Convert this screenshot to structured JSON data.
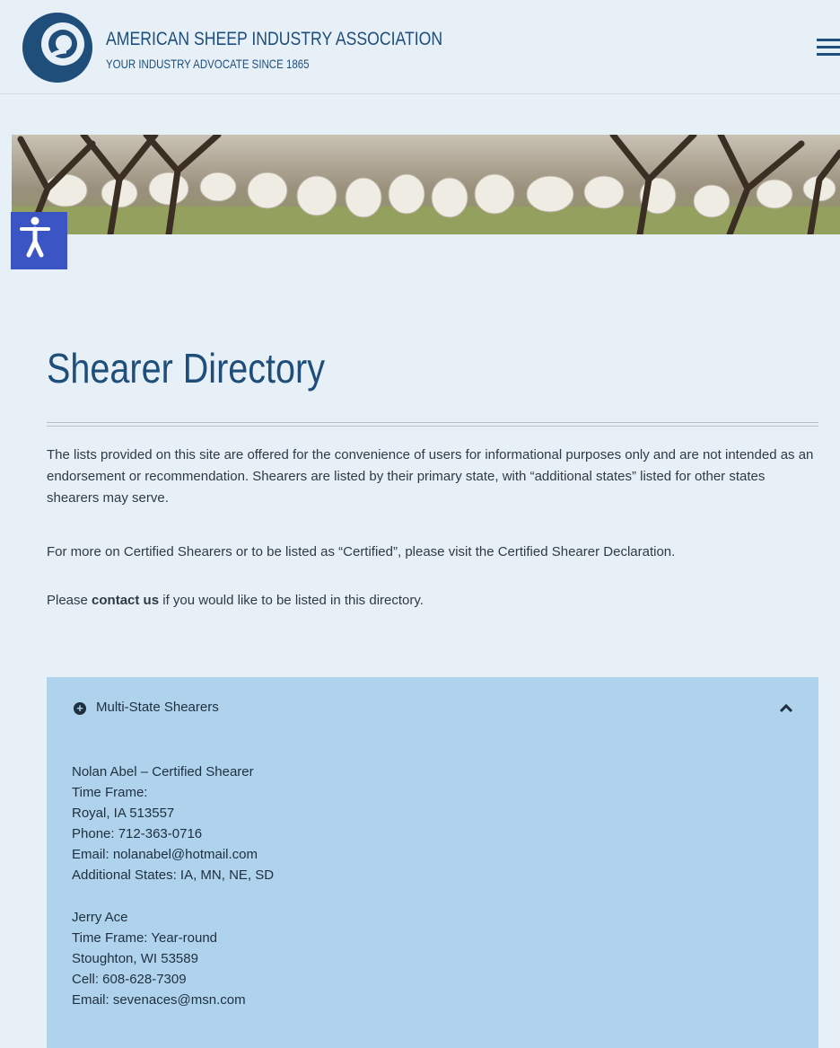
{
  "header": {
    "org_name": "AMERICAN SHEEP INDUSTRY ASSOCIATION",
    "tagline": "YOUR INDUSTRY ADVOCATE SINCE 1865",
    "colors": {
      "brand": "#1e4e79",
      "accessibility": "#3c55c4",
      "panel": "#afd3ec"
    }
  },
  "page": {
    "title": "Shearer Directory",
    "intro": "The lists provided on this site are offered for the convenience of users for informational purposes only and are not intended as an endorsement or recommendation. Shearers are listed by their primary state, with “additional states” listed for other states shearers may serve.",
    "certified_note": "For more on Certified Shearers or to be listed as “Certified”, please visit the Certified Shearer Declaration.",
    "contact_prefix": "Please ",
    "contact_link": "contact us",
    "contact_suffix": " if you would like to be listed in this directory."
  },
  "accordion": {
    "title": "Multi-State Shearers",
    "entries": [
      {
        "name": "Nolan Abel – Certified Shearer",
        "time_frame": "Time Frame:",
        "location": "Royal, IA 513557",
        "phone": "Phone: 712-363-0716",
        "email": "Email: nolanabel@hotmail.com",
        "additional": "Additional States: IA, MN, NE, SD"
      },
      {
        "name": "Jerry Ace",
        "time_frame": "Time Frame: Year-round",
        "location": "Stoughton, WI 53589",
        "phone": "Cell: 608-628-7309",
        "email": "Email: sevenaces@msn.com"
      }
    ]
  }
}
